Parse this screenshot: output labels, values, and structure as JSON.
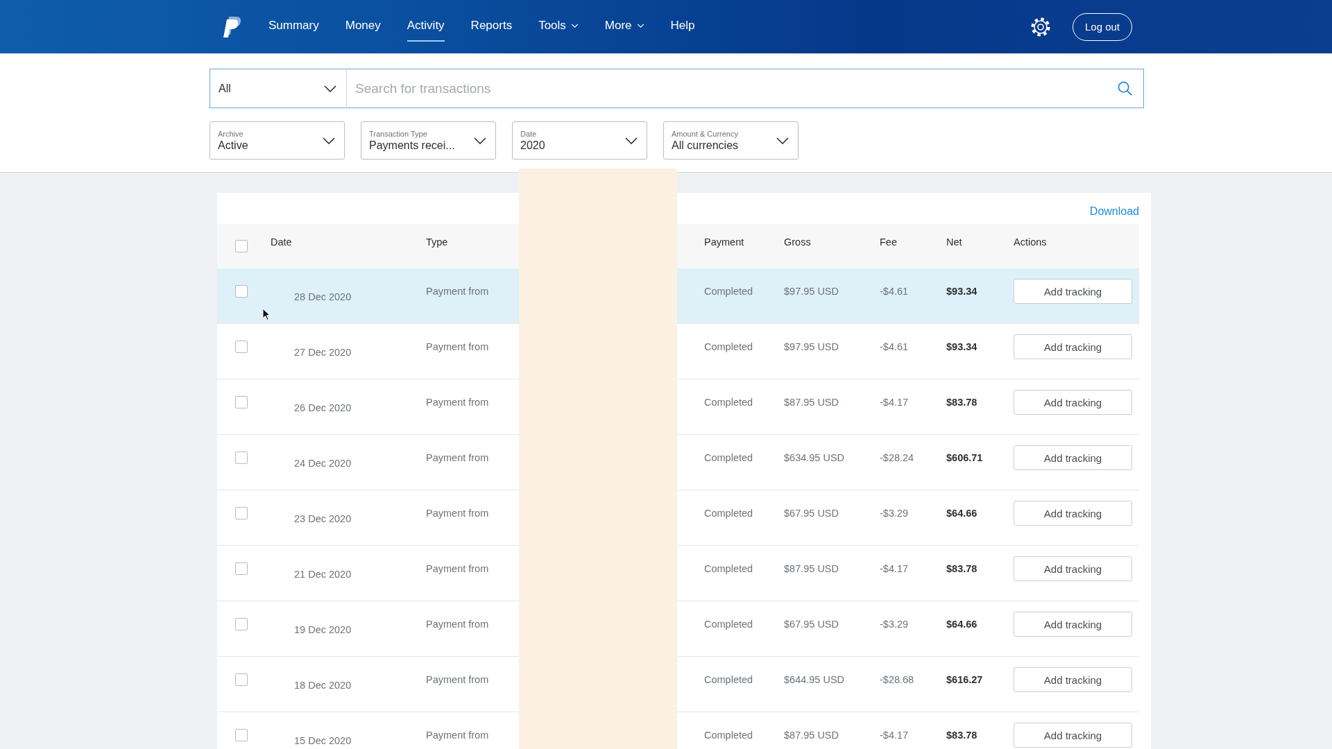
{
  "header": {
    "nav": [
      {
        "label": "Summary",
        "selected": false,
        "has_menu": false
      },
      {
        "label": "Money",
        "selected": false,
        "has_menu": false
      },
      {
        "label": "Activity",
        "selected": true,
        "has_menu": false
      },
      {
        "label": "Reports",
        "selected": false,
        "has_menu": false
      },
      {
        "label": "Tools",
        "selected": false,
        "has_menu": true
      },
      {
        "label": "More",
        "selected": false,
        "has_menu": true
      },
      {
        "label": "Help",
        "selected": false,
        "has_menu": false
      }
    ],
    "logout": "Log out"
  },
  "search": {
    "scope": "All",
    "placeholder": "Search for transactions"
  },
  "filters": [
    {
      "label": "Archive",
      "value": "Active"
    },
    {
      "label": "Transaction Type",
      "value": "Payments recei..."
    },
    {
      "label": "Date",
      "value": "2020"
    },
    {
      "label": "Amount & Currency",
      "value": "All currencies"
    }
  ],
  "table": {
    "download": "Download",
    "select_all_checked": false,
    "columns": [
      "Date",
      "Type",
      "Payment",
      "Gross",
      "Fee",
      "Net",
      "Actions"
    ],
    "rows": [
      {
        "date": "28 Dec 2020",
        "type": "Payment from",
        "status": "Completed",
        "gross": "$97.95 USD",
        "fee": "-$4.61",
        "net": "$93.34",
        "action": "Add tracking",
        "checked": false,
        "highlighted": true
      },
      {
        "date": "27 Dec 2020",
        "type": "Payment from",
        "status": "Completed",
        "gross": "$97.95 USD",
        "fee": "-$4.61",
        "net": "$93.34",
        "action": "Add tracking",
        "checked": false,
        "highlighted": false
      },
      {
        "date": "26 Dec 2020",
        "type": "Payment from",
        "status": "Completed",
        "gross": "$87.95 USD",
        "fee": "-$4.17",
        "net": "$83.78",
        "action": "Add tracking",
        "checked": false,
        "highlighted": false
      },
      {
        "date": "24 Dec 2020",
        "type": "Payment from",
        "status": "Completed",
        "gross": "$634.95 USD",
        "fee": "-$28.24",
        "net": "$606.71",
        "action": "Add tracking",
        "checked": false,
        "highlighted": false
      },
      {
        "date": "23 Dec 2020",
        "type": "Payment from",
        "status": "Completed",
        "gross": "$67.95 USD",
        "fee": "-$3.29",
        "net": "$64.66",
        "action": "Add tracking",
        "checked": false,
        "highlighted": false
      },
      {
        "date": "21 Dec 2020",
        "type": "Payment from",
        "status": "Completed",
        "gross": "$87.95 USD",
        "fee": "-$4.17",
        "net": "$83.78",
        "action": "Add tracking",
        "checked": false,
        "highlighted": false
      },
      {
        "date": "19 Dec 2020",
        "type": "Payment from",
        "status": "Completed",
        "gross": "$67.95 USD",
        "fee": "-$3.29",
        "net": "$64.66",
        "action": "Add tracking",
        "checked": false,
        "highlighted": false
      },
      {
        "date": "18 Dec 2020",
        "type": "Payment from",
        "status": "Completed",
        "gross": "$644.95 USD",
        "fee": "-$28.68",
        "net": "$616.27",
        "action": "Add tracking",
        "checked": false,
        "highlighted": false
      },
      {
        "date": "15 Dec 2020",
        "type": "Payment from",
        "status": "Completed",
        "gross": "$87.95 USD",
        "fee": "-$4.17",
        "net": "$83.78",
        "action": "Add tracking",
        "checked": false,
        "highlighted": false
      }
    ]
  }
}
